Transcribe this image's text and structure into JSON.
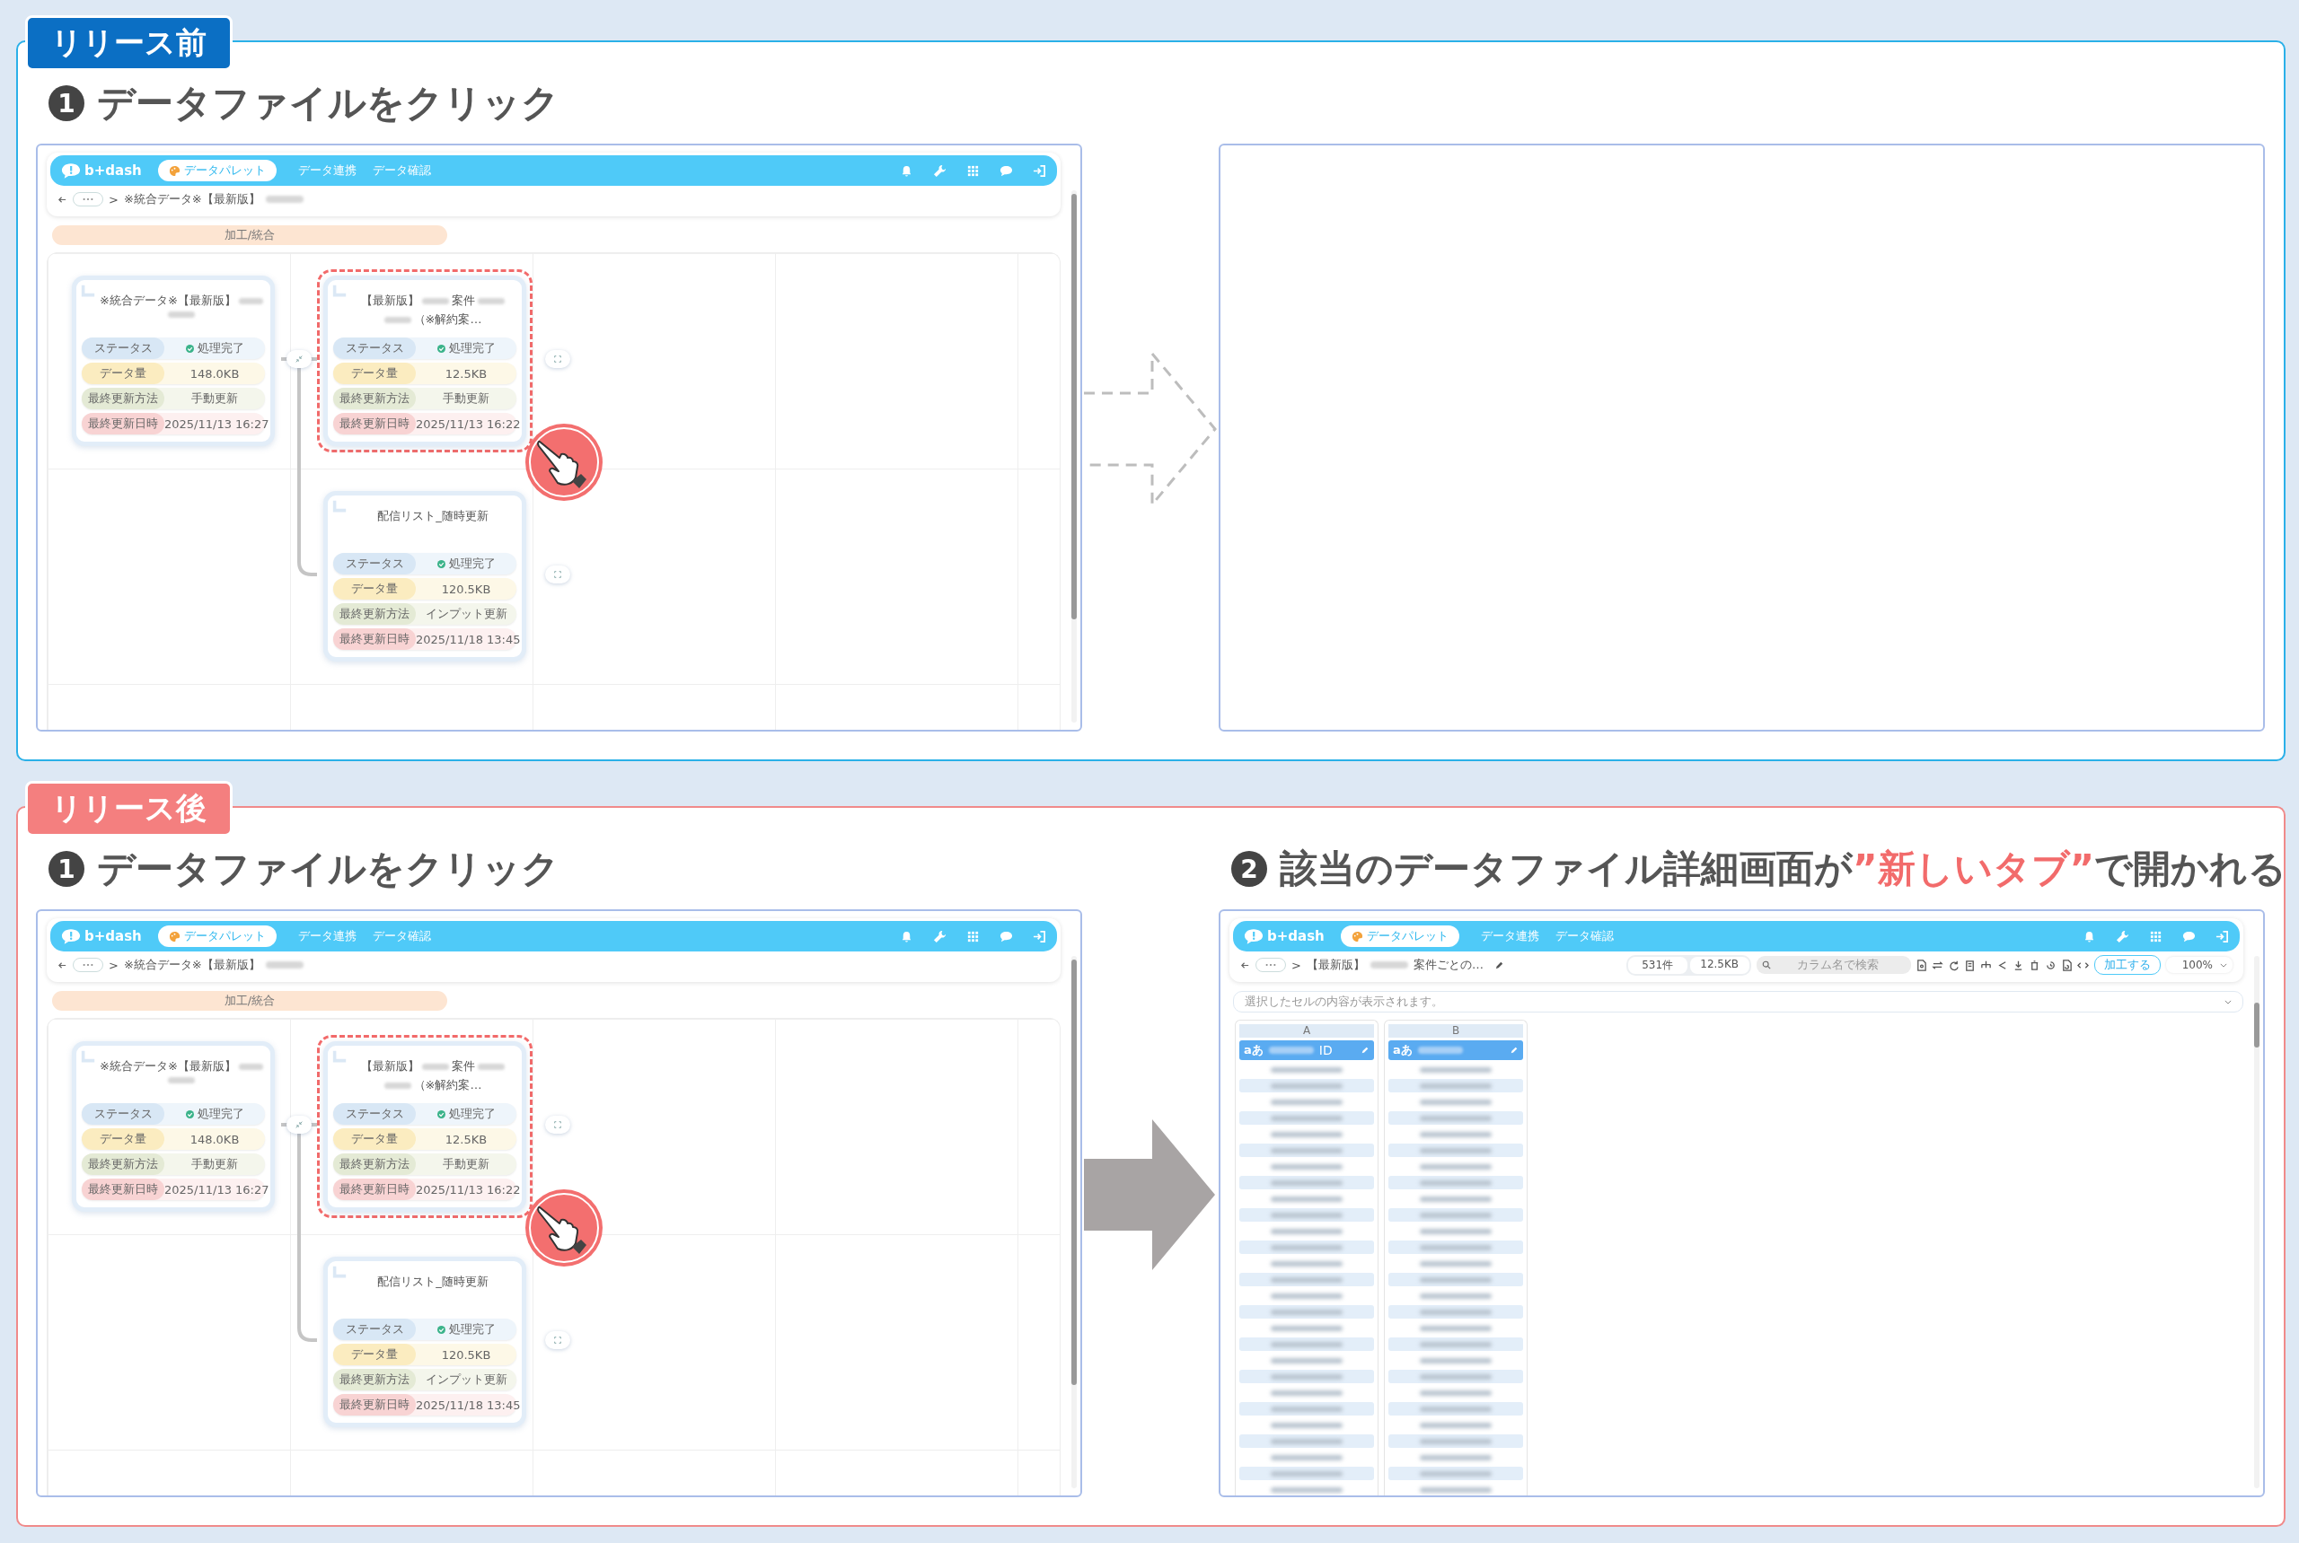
{
  "sections": [
    {
      "kind": "before",
      "tag": "リリース前",
      "arrow_dashed": true,
      "panels": [
        {
          "kind": "flow",
          "step": {
            "number": "1",
            "parts": [
              {
                "text": "データファイルをクリック",
                "highlight": false
              }
            ]
          },
          "header": {
            "logo": "b+dash",
            "app": "データパレット",
            "nav": [
              "データ連携",
              "データ確認"
            ]
          },
          "breadcrumb": {
            "separator": ">",
            "parts": [
              {
                "kind": "text",
                "text": "※統合データ※【最新版】"
              },
              {
                "kind": "redacted"
              }
            ]
          },
          "process": "加工/統合",
          "tree": {
            "selected": false,
            "title_lines": [
              [
                {
                  "kind": "text",
                  "text": "※統合データ※【最新版】"
                },
                {
                  "kind": "redacted"
                }
              ],
              [
                {
                  "kind": "redacted"
                }
              ]
            ],
            "rows": [
              {
                "kind": "status",
                "label": "ステータス",
                "value": "処理完了"
              },
              {
                "kind": "size",
                "label": "データ量",
                "value": "148.0KB"
              },
              {
                "kind": "method",
                "label": "最終更新方法",
                "value": "手動更新"
              },
              {
                "kind": "date",
                "label": "最終更新日時",
                "value": "2025/11/13 16:27"
              }
            ],
            "children": [
              {
                "selected": true,
                "title_lines": [
                  [
                    {
                      "kind": "text",
                      "text": "【最新版】"
                    },
                    {
                      "kind": "redacted"
                    },
                    {
                      "kind": "text",
                      "text": "案件"
                    },
                    {
                      "kind": "redacted"
                    }
                  ],
                  [
                    {
                      "kind": "redacted"
                    },
                    {
                      "kind": "text",
                      "text": "（※解約案…"
                    }
                  ]
                ],
                "rows": [
                  {
                    "kind": "status",
                    "label": "ステータス",
                    "value": "処理完了"
                  },
                  {
                    "kind": "size",
                    "label": "データ量",
                    "value": "12.5KB"
                  },
                  {
                    "kind": "method",
                    "label": "最終更新方法",
                    "value": "手動更新"
                  },
                  {
                    "kind": "date",
                    "label": "最終更新日時",
                    "value": "2025/11/13 16:22"
                  }
                ]
              },
              {
                "selected": false,
                "title_lines": [
                  [
                    {
                      "kind": "text",
                      "text": "配信リスト_随時更新"
                    }
                  ]
                ],
                "rows": [
                  {
                    "kind": "status",
                    "label": "ステータス",
                    "value": "処理完了"
                  },
                  {
                    "kind": "size",
                    "label": "データ量",
                    "value": "120.5KB"
                  },
                  {
                    "kind": "method",
                    "label": "最終更新方法",
                    "value": "インプット更新"
                  },
                  {
                    "kind": "date",
                    "label": "最終更新日時",
                    "value": "2025/11/18 13:45"
                  }
                ]
              }
            ]
          }
        },
        {
          "kind": "empty"
        }
      ]
    },
    {
      "kind": "after",
      "tag": "リリース後",
      "arrow_dashed": false,
      "panels": [
        {
          "kind": "flow",
          "step": {
            "number": "1",
            "parts": [
              {
                "text": "データファイルをクリック",
                "highlight": false
              }
            ]
          },
          "header": {
            "logo": "b+dash",
            "app": "データパレット",
            "nav": [
              "データ連携",
              "データ確認"
            ]
          },
          "breadcrumb": {
            "separator": ">",
            "parts": [
              {
                "kind": "text",
                "text": "※統合データ※【最新版】"
              },
              {
                "kind": "redacted"
              }
            ]
          },
          "process": "加工/統合",
          "tree": {
            "selected": false,
            "title_lines": [
              [
                {
                  "kind": "text",
                  "text": "※統合データ※【最新版】"
                },
                {
                  "kind": "redacted"
                }
              ],
              [
                {
                  "kind": "redacted"
                }
              ]
            ],
            "rows": [
              {
                "kind": "status",
                "label": "ステータス",
                "value": "処理完了"
              },
              {
                "kind": "size",
                "label": "データ量",
                "value": "148.0KB"
              },
              {
                "kind": "method",
                "label": "最終更新方法",
                "value": "手動更新"
              },
              {
                "kind": "date",
                "label": "最終更新日時",
                "value": "2025/11/13 16:27"
              }
            ],
            "children": [
              {
                "selected": true,
                "title_lines": [
                  [
                    {
                      "kind": "text",
                      "text": "【最新版】"
                    },
                    {
                      "kind": "redacted"
                    },
                    {
                      "kind": "text",
                      "text": "案件"
                    },
                    {
                      "kind": "redacted"
                    }
                  ],
                  [
                    {
                      "kind": "redacted"
                    },
                    {
                      "kind": "text",
                      "text": "（※解約案…"
                    }
                  ]
                ],
                "rows": [
                  {
                    "kind": "status",
                    "label": "ステータス",
                    "value": "処理完了"
                  },
                  {
                    "kind": "size",
                    "label": "データ量",
                    "value": "12.5KB"
                  },
                  {
                    "kind": "method",
                    "label": "最終更新方法",
                    "value": "手動更新"
                  },
                  {
                    "kind": "date",
                    "label": "最終更新日時",
                    "value": "2025/11/13 16:22"
                  }
                ]
              },
              {
                "selected": false,
                "title_lines": [
                  [
                    {
                      "kind": "text",
                      "text": "配信リスト_随時更新"
                    }
                  ]
                ],
                "rows": [
                  {
                    "kind": "status",
                    "label": "ステータス",
                    "value": "処理完了"
                  },
                  {
                    "kind": "size",
                    "label": "データ量",
                    "value": "120.5KB"
                  },
                  {
                    "kind": "method",
                    "label": "最終更新方法",
                    "value": "インプット更新"
                  },
                  {
                    "kind": "date",
                    "label": "最終更新日時",
                    "value": "2025/11/18 13:45"
                  }
                ]
              }
            ]
          }
        },
        {
          "kind": "detail",
          "step": {
            "number": "2",
            "parts": [
              {
                "text": "該当のデータファイル詳細画面が",
                "highlight": false
              },
              {
                "text": "”新しいタブ”",
                "highlight": true
              },
              {
                "text": "で開かれる",
                "highlight": false
              }
            ]
          },
          "header": {
            "logo": "b+dash",
            "app": "データパレット",
            "nav": [
              "データ連携",
              "データ確認"
            ]
          },
          "breadcrumb": {
            "separator": ">",
            "editable": true,
            "parts": [
              {
                "kind": "text",
                "text": "【最新版】"
              },
              {
                "kind": "redacted"
              },
              {
                "kind": "text",
                "text": "案件ごとの…"
              }
            ]
          },
          "toolbar": {
            "stats": [
              "531件",
              "12.5KB"
            ],
            "search": {
              "placeholder": "カラム名で検索"
            },
            "action": "加工する",
            "zoom": "100%"
          },
          "cell_bar": {
            "placeholder": "選択したセルの内容が表示されます。"
          },
          "columns": [
            {
              "letter": "A",
              "type": "aあ",
              "name_parts": [
                {
                  "kind": "redacted"
                },
                {
                  "kind": "text",
                  "text": "ID"
                }
              ]
            },
            {
              "letter": "B",
              "type": "aあ",
              "name_parts": [
                {
                  "kind": "redacted"
                }
              ]
            }
          ]
        }
      ]
    }
  ]
}
